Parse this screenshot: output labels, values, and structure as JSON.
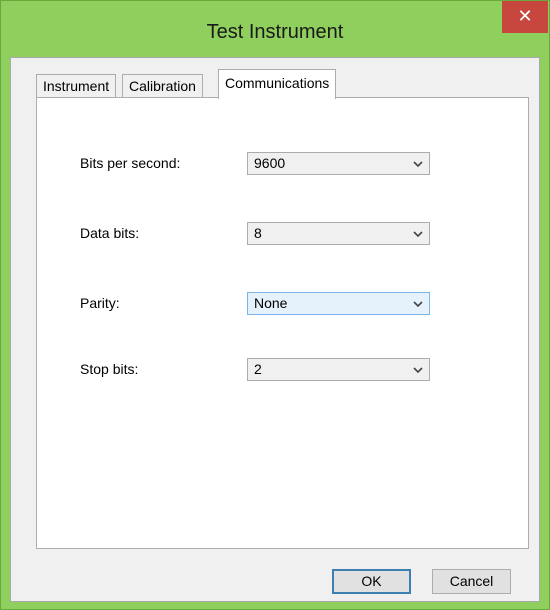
{
  "window": {
    "title": "Test Instrument",
    "close_label": "✕"
  },
  "tabs": [
    {
      "label": "Instrument",
      "active": false
    },
    {
      "label": "Calibration",
      "active": false
    },
    {
      "label": "Communications",
      "active": true
    }
  ],
  "fields": [
    {
      "label": "Bits per second:",
      "value": "9600"
    },
    {
      "label": "Data bits:",
      "value": "8"
    },
    {
      "label": "Parity:",
      "value": "None",
      "focused": true
    },
    {
      "label": "Stop bits:",
      "value": "2"
    }
  ],
  "buttons": {
    "ok": "OK",
    "cancel": "Cancel"
  },
  "colors": {
    "titlebar": "#8fcf5e",
    "close": "#c7463d",
    "focus": "#7eb4ea"
  }
}
